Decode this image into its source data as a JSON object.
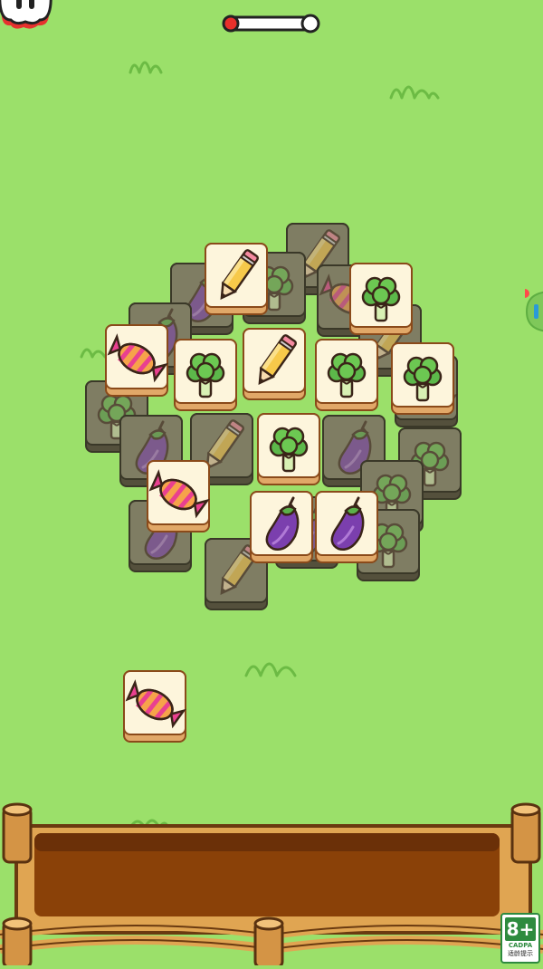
{
  "hud": {
    "pause_icon": "pause-icon",
    "progress_fraction": 0.05,
    "side_tab_icon": "side-panel-tab-icon"
  },
  "tiles_in_play": {
    "shaded_lower_layer": [
      "pencil",
      "eggplant",
      "broccoli",
      "candy",
      "eggplant",
      "pencil",
      "broccoli",
      "candy",
      "eggplant",
      "pencil",
      "broccoli",
      "eggplant",
      "broccoli",
      "broccoli",
      "pencil",
      "eggplant",
      "eggplant"
    ],
    "selectable_top_layer": [
      "pencil",
      "broccoli",
      "candy",
      "broccoli",
      "pencil",
      "broccoli",
      "broccoli",
      "broccoli",
      "candy",
      "eggplant",
      "eggplant"
    ],
    "lone_tile": "candy"
  },
  "collection_tray": {
    "slots_filled": 0
  },
  "age_rating": {
    "value": "8+",
    "org": "CADPA",
    "tip": "适龄提示"
  },
  "colors": {
    "background": "#9be06a",
    "tile_face": "#fdf5dc",
    "tile_edge": "#e1a868",
    "shaded_tile": "#7f7d63",
    "tray_wood": "#e0a552",
    "tray_inner": "#8a4108"
  }
}
